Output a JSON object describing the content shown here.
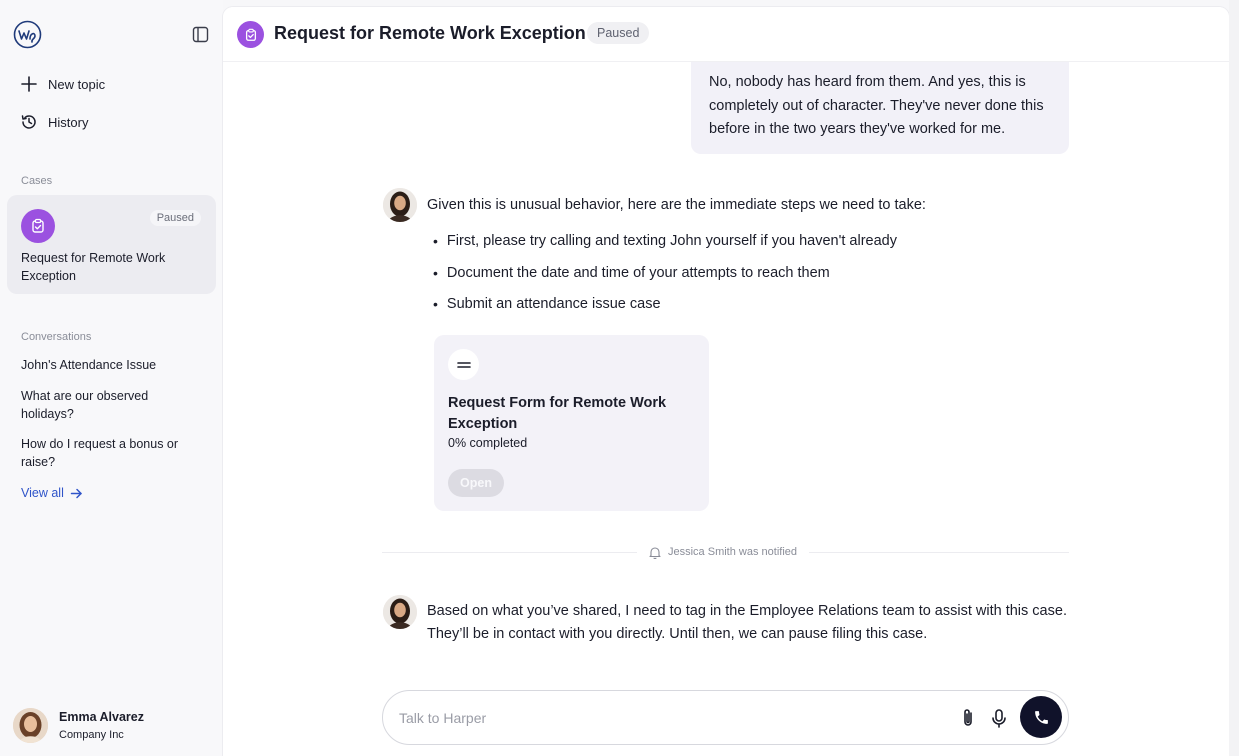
{
  "sidebar": {
    "nav": {
      "new_topic": "New topic",
      "history": "History"
    },
    "cases_label": "Cases",
    "case": {
      "badge": "Paused",
      "title": "Request for Remote Work Exception"
    },
    "conversations_label": "Conversations",
    "conversations": [
      "John's Attendance Issue",
      "What are our observed holidays?",
      "How do I request a bonus or raise?"
    ],
    "view_all": "View all",
    "user": {
      "name": "Emma Alvarez",
      "company": "Company Inc"
    }
  },
  "header": {
    "title": "Request for Remote Work Exception",
    "status": "Paused"
  },
  "messages": {
    "user_reply": "No, nobody has heard from them. And yes, this is completely out of character. They've never done this before in the two years they've worked for me.",
    "bot_intro": "Given this is unusual behavior, here are the immediate steps we need to take:",
    "bullets": [
      "First, please try calling and texting John yourself if you haven't already",
      "Document the date and time of your attempts to reach them",
      "Submit an attendance issue case"
    ],
    "form": {
      "title": "Request Form for Remote Work Exception",
      "progress": "0% completed",
      "progress_value": 0,
      "button": "Open"
    },
    "notification": "Jessica Smith was notified",
    "bot_final": "Based on what you’ve shared, I need to tag in the Employee Relations team to assist with this case. They’ll be in contact with you directly. Until then, we can pause filing this case."
  },
  "composer": {
    "placeholder": "Talk to Harper"
  },
  "colors": {
    "accent_purple": "#9b51e0",
    "link_blue": "#2f54c9",
    "call_button": "#10122a"
  }
}
